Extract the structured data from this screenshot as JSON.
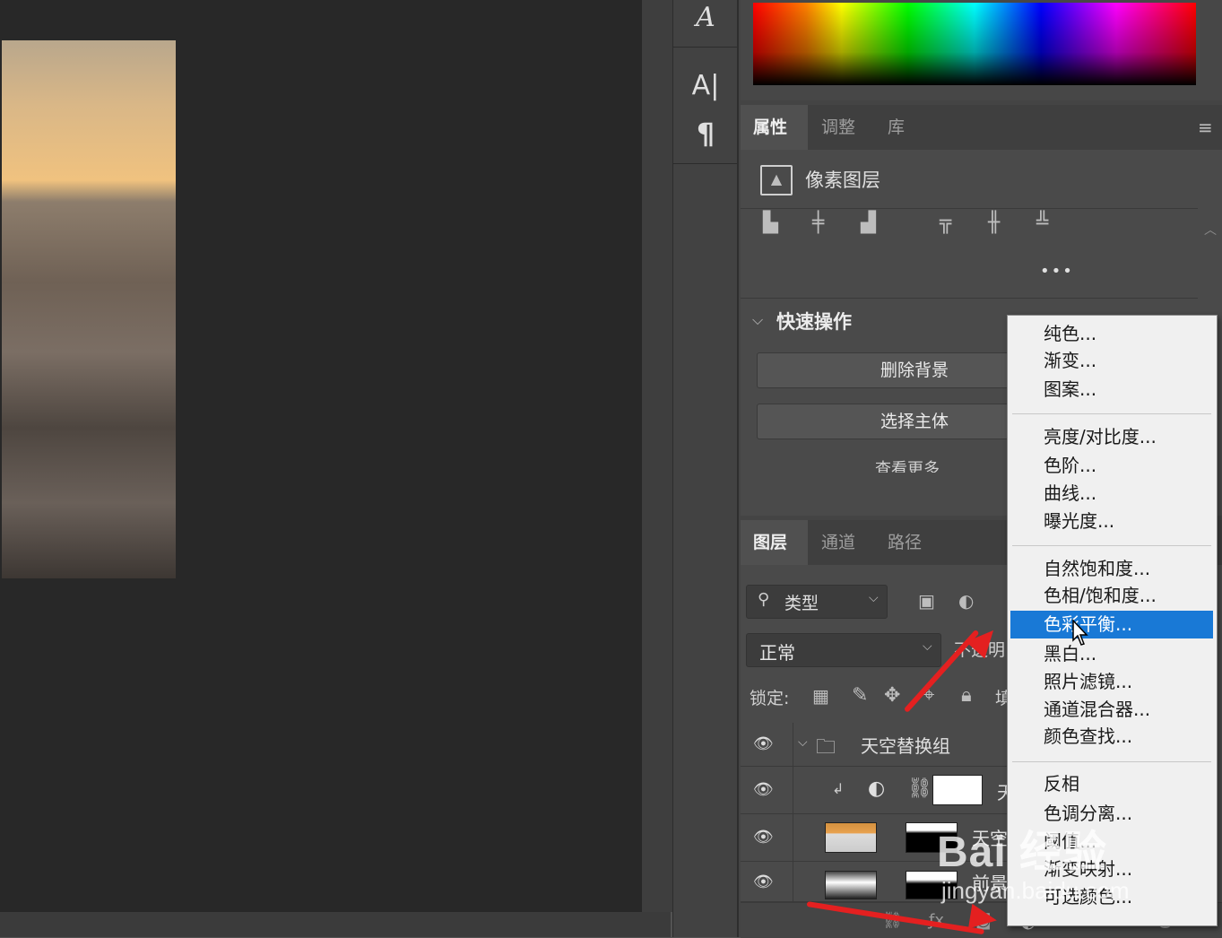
{
  "toolstrip": {
    "icons": [
      "A",
      "A|",
      "¶"
    ]
  },
  "properties_panel": {
    "tabs": [
      "属性",
      "调整",
      "库"
    ],
    "layer_type": "像素图层",
    "more": "•••",
    "quick_actions": {
      "title": "快速操作",
      "buttons": [
        "删除背景",
        "选择主体",
        "查看更多"
      ]
    }
  },
  "layers_panel": {
    "tabs": [
      "图层",
      "通道",
      "路径"
    ],
    "filter_label": "类型",
    "blend_mode": "正常",
    "opacity_label": "不透明",
    "lock_label": "锁定:",
    "fill_label": "填",
    "layers": [
      {
        "name": "天空替换组",
        "kind": "group"
      },
      {
        "name": "天",
        "kind": "adjustment"
      },
      {
        "name": "天空",
        "kind": "sky"
      },
      {
        "name": "前景",
        "kind": "foreground"
      }
    ]
  },
  "menu": {
    "groups": [
      [
        "纯色...",
        "渐变...",
        "图案..."
      ],
      [
        "亮度/对比度...",
        "色阶...",
        "曲线...",
        "曝光度..."
      ],
      [
        "自然饱和度...",
        "色相/饱和度...",
        "色彩平衡...",
        "黑白...",
        "照片滤镜...",
        "通道混合器...",
        "颜色查找..."
      ],
      [
        "反相",
        "色调分离...",
        "阈值...",
        "渐变映射...",
        "可选颜色..."
      ]
    ],
    "selected": "色彩平衡..."
  },
  "watermark": {
    "brand": "Bai 经验",
    "url": "jingyan.baidu.com"
  },
  "colors": {
    "accent": "#1979d6",
    "arrow": "#e42020",
    "canvas": "#282828",
    "panel": "#4a4a4a"
  }
}
